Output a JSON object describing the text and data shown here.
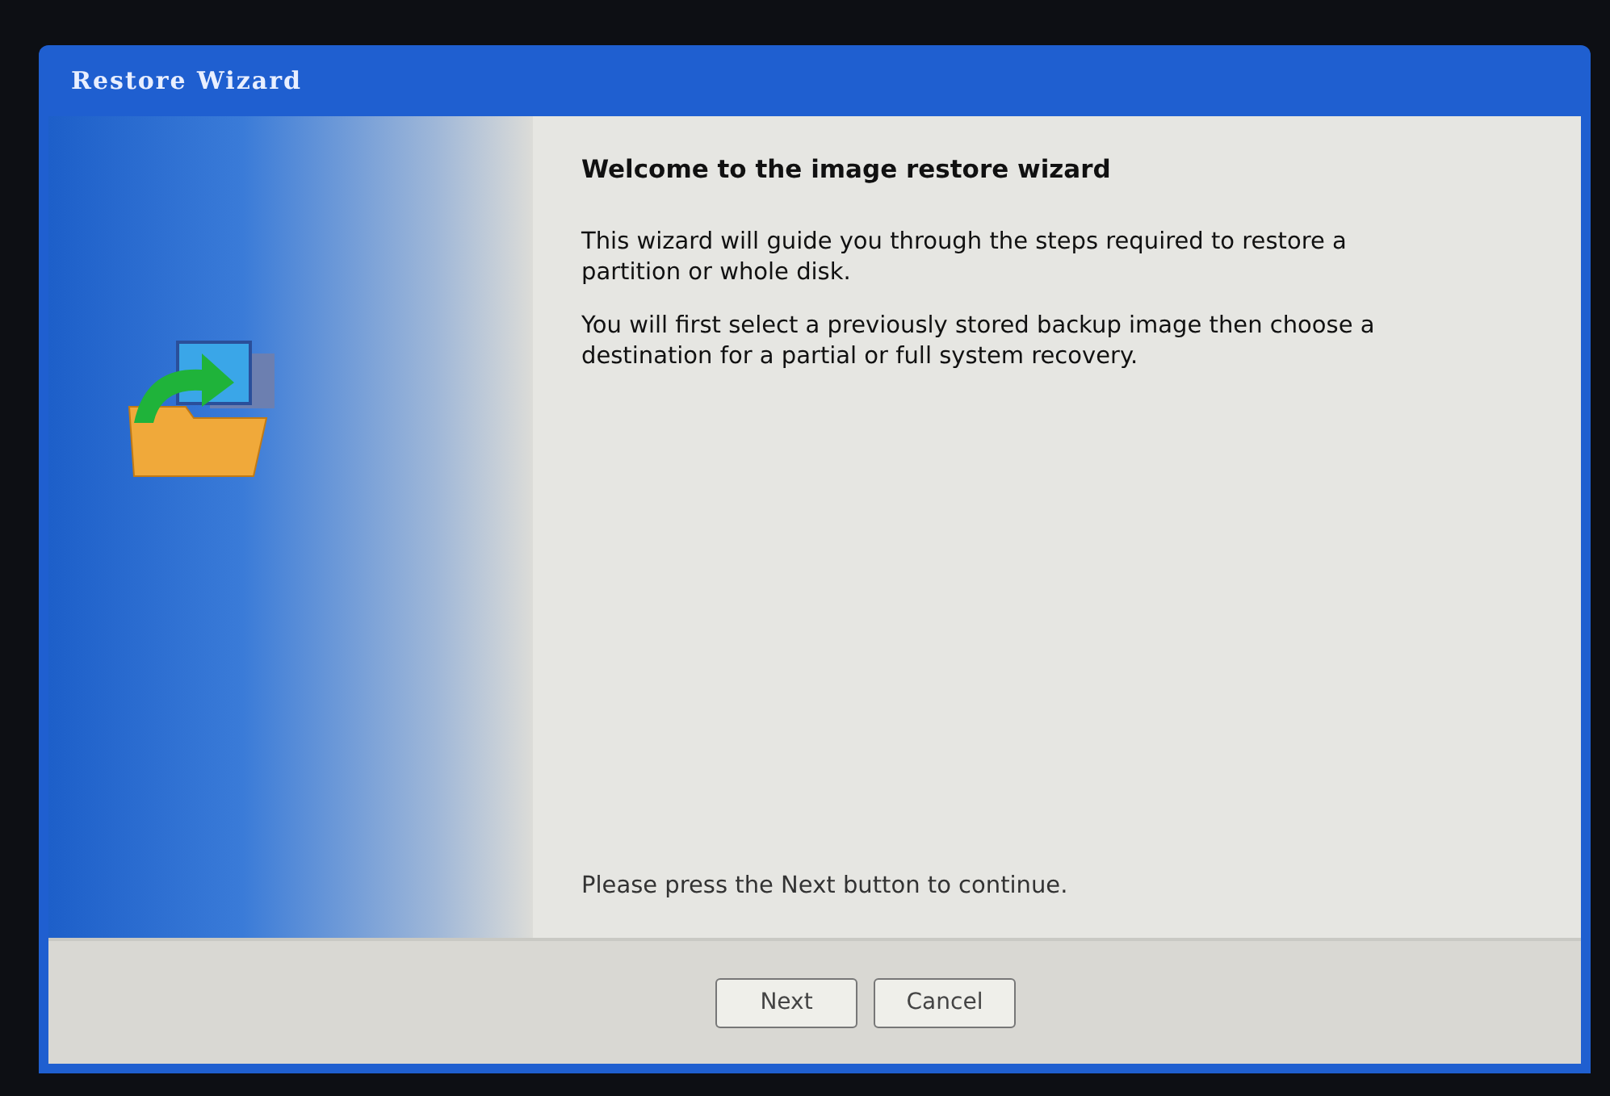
{
  "window": {
    "title": "Restore Wizard"
  },
  "heading": "Welcome to the image restore wizard",
  "paragraphs": [
    "This wizard will guide you through the steps required to restore a partition or whole disk.",
    "You will first select a previously stored backup image then choose a destination for a partial or full system recovery."
  ],
  "instruction": "Please press the Next button to continue.",
  "buttons": [
    {
      "label": "Next"
    },
    {
      "label": "Cancel"
    }
  ]
}
